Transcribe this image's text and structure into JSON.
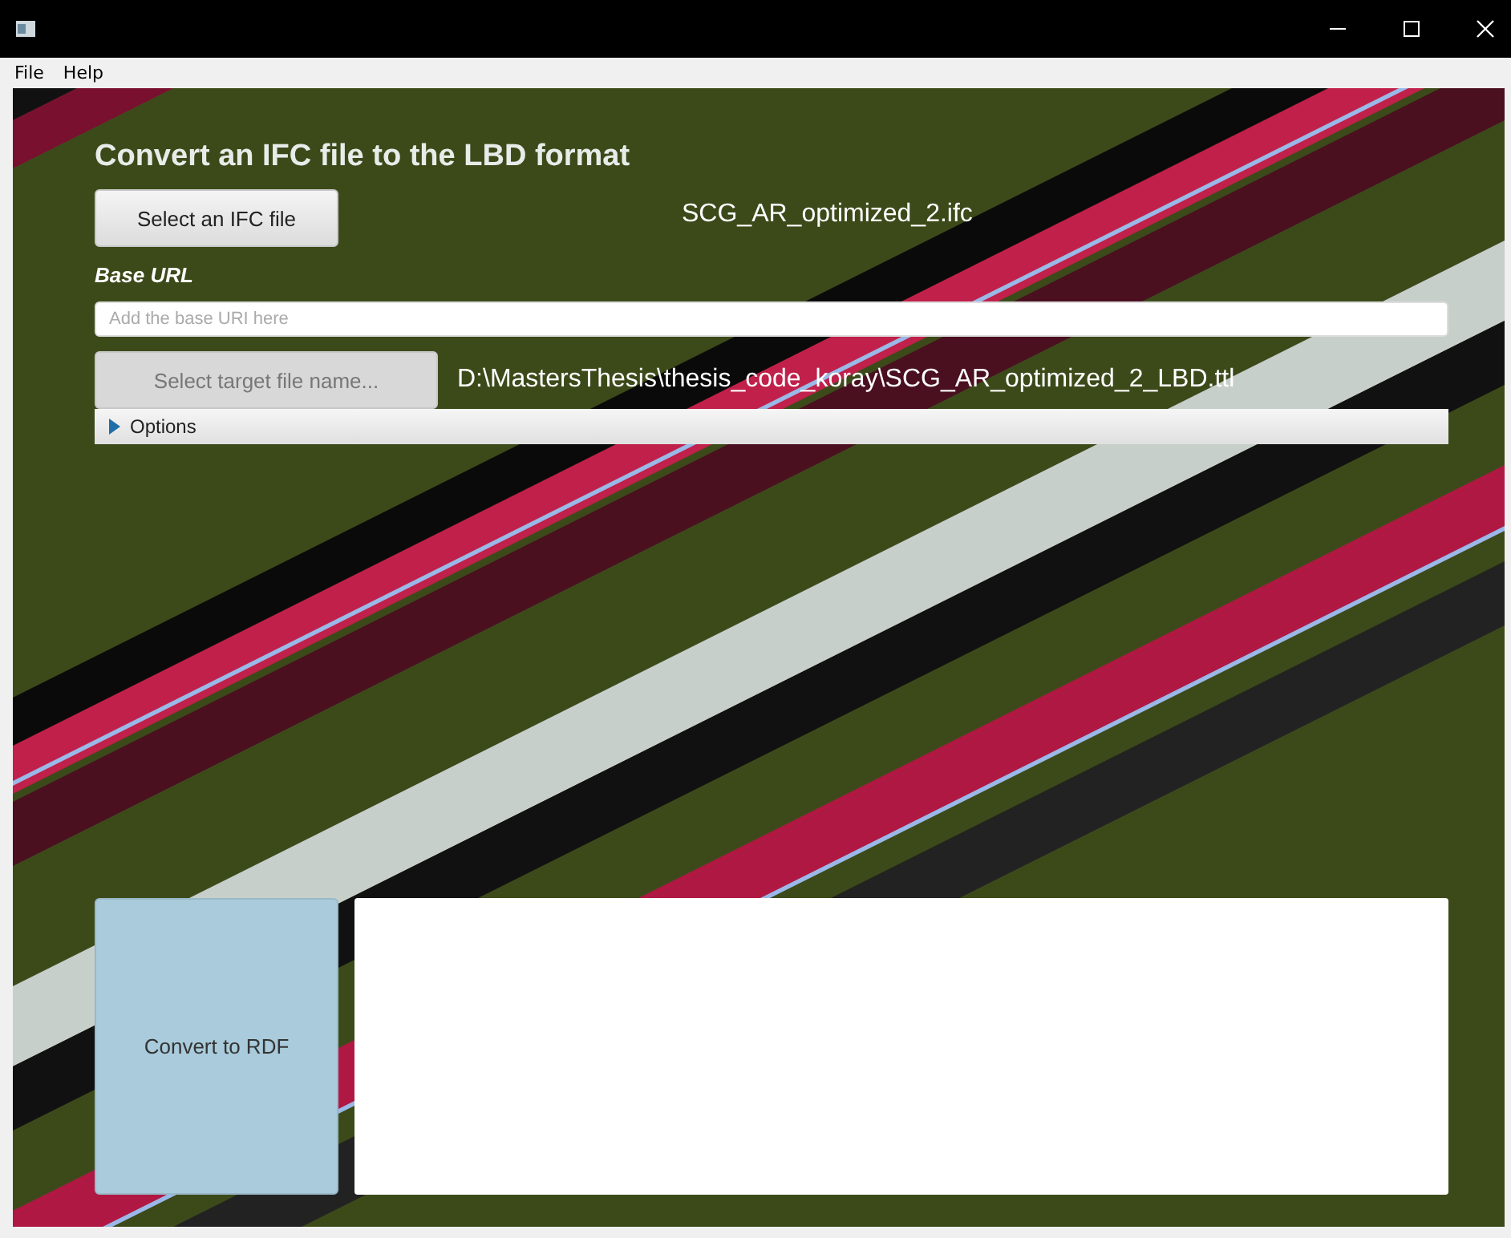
{
  "menu": [
    {
      "label": "File"
    },
    {
      "label": "Help"
    }
  ],
  "heading": "Convert an IFC file to the LBD  format",
  "ifc_button": {
    "label": "Select an IFC file",
    "disabled": false
  },
  "ifc_file": "SCG_AR_optimized_2.ifc",
  "base_url": {
    "label": "Base URL",
    "placeholder": "Add the base URI here"
  },
  "target_button": {
    "label": "Select target file name...",
    "disabled": true
  },
  "target_path": "D:\\MastersThesis\\thesis_code_koray\\SCG_AR_optimized_2_LBD.ttl",
  "options": {
    "label": "Options",
    "expanded": false
  },
  "convert_button": {
    "label": "Convert to RDF"
  }
}
